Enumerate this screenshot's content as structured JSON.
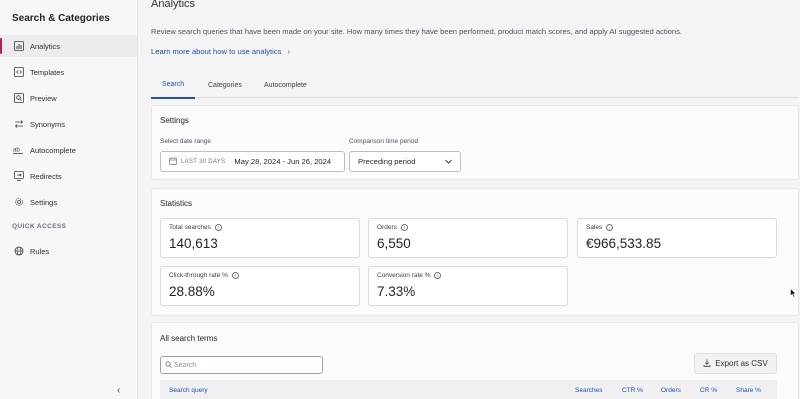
{
  "sidebar": {
    "title": "Search & Categories",
    "items": [
      {
        "label": "Analytics",
        "icon": "bar-chart-icon",
        "active": true
      },
      {
        "label": "Templates",
        "icon": "code-brackets-icon"
      },
      {
        "label": "Preview",
        "icon": "search-preview-icon"
      },
      {
        "label": "Synonyms",
        "icon": "swap-arrows-icon"
      },
      {
        "label": "Autocomplete",
        "icon": "autocomplete-ab-icon"
      },
      {
        "label": "Redirects",
        "icon": "redirect-icon"
      },
      {
        "label": "Settings",
        "icon": "gear-icon"
      }
    ],
    "section_label": "QUICK ACCESS",
    "quick": [
      {
        "label": "Rules",
        "icon": "globe-icon"
      }
    ],
    "collapse_glyph": "‹"
  },
  "header": {
    "title": "Analytics",
    "description": "Review search queries that have been made on your site. How many times they have been performed, product match scores, and apply AI suggested actions.",
    "learn_link": "Learn more about how to use analytics",
    "learn_arrow": "›"
  },
  "tabs": [
    {
      "label": "Search",
      "active": true
    },
    {
      "label": "Categories"
    },
    {
      "label": "Autocomplete"
    }
  ],
  "settings": {
    "title": "Settings",
    "date_label": "Select date range",
    "date_prefix": "LAST 30 DAYS",
    "date_value": "May 28, 2024 - Jun 26, 2024",
    "comparison_label": "Comparison time period",
    "comparison_value": "Preceding period"
  },
  "statistics": {
    "title": "Statistics",
    "items": [
      {
        "label": "Total searches",
        "value": "140,613"
      },
      {
        "label": "Orders",
        "value": "6,550"
      },
      {
        "label": "Sales",
        "value": "€966,533.85"
      },
      {
        "label": "Click-through rate %",
        "value": "28.88%"
      },
      {
        "label": "Conversion rate %",
        "value": "7.33%"
      }
    ],
    "info_glyph": "i"
  },
  "search_terms": {
    "title": "All search terms",
    "search_placeholder": "Search",
    "export_label": "Export as CSV",
    "columns": [
      "Search query",
      "Searches",
      "CTR %",
      "Orders",
      "CR %",
      "Share %"
    ]
  },
  "colors": {
    "accent": "#2152a3",
    "active_marker": "#c2185b"
  }
}
